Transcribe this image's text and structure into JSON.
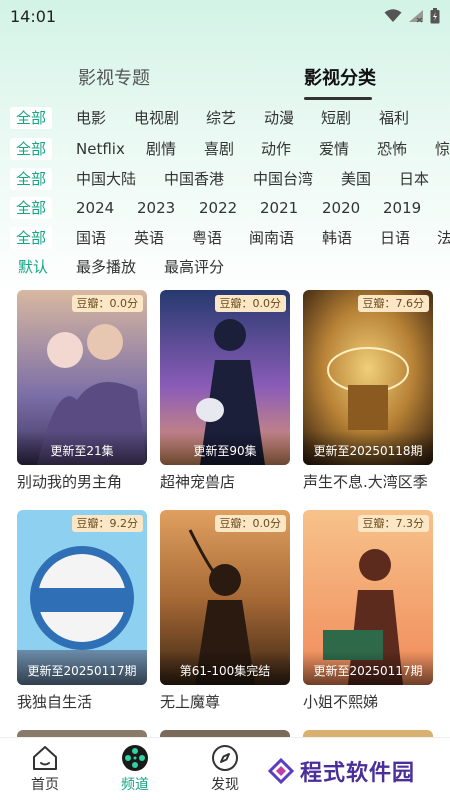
{
  "status": {
    "time": "14:01"
  },
  "top_tabs": [
    {
      "label": "影视专题"
    },
    {
      "label": "影视分类"
    }
  ],
  "filters": {
    "row1": [
      "全部",
      "电影",
      "电视剧",
      "综艺",
      "动漫",
      "短剧",
      "福利"
    ],
    "row2": [
      "全部",
      "Netflix",
      "剧情",
      "喜剧",
      "动作",
      "爱情",
      "恐怖",
      "惊"
    ],
    "row3": [
      "全部",
      "中国大陆",
      "中国香港",
      "中国台湾",
      "美国",
      "日本"
    ],
    "row4": [
      "全部",
      "2024",
      "2023",
      "2022",
      "2021",
      "2020",
      "2019"
    ],
    "row5": [
      "全部",
      "国语",
      "英语",
      "粤语",
      "闽南语",
      "韩语",
      "日语",
      "法"
    ],
    "sort": [
      "默认",
      "最多播放",
      "最高评分"
    ]
  },
  "cards": [
    {
      "title": "别动我的男主角",
      "rating": "豆瓣：0.0分",
      "update": "更新至21集",
      "colors": [
        "#d8b8a0",
        "#7c6fa7",
        "#f2d8d0"
      ]
    },
    {
      "title": "超神宠兽店",
      "rating": "豆瓣：0.0分",
      "update": "更新至90集",
      "colors": [
        "#263a6e",
        "#8a5cb8",
        "#e49a6a"
      ]
    },
    {
      "title": "声生不息.大湾区季",
      "rating": "豆瓣：7.6分",
      "update": "更新至20250118期",
      "colors": [
        "#3a2410",
        "#b88236",
        "#f0cf7a"
      ]
    },
    {
      "title": "我独自生活",
      "rating": "豆瓣：9.2分",
      "update": "更新至20250117期",
      "colors": [
        "#8ed0ef",
        "#2f6fb6",
        "#f4f4f4"
      ]
    },
    {
      "title": "无上魔尊",
      "rating": "豆瓣：0.0分",
      "update": "第61-100集完结",
      "colors": [
        "#3b2614",
        "#a86a36",
        "#e0a060"
      ]
    },
    {
      "title": "小姐不熙娣",
      "rating": "豆瓣：7.3分",
      "update": "更新至20250117期",
      "colors": [
        "#f08a5a",
        "#f7c28a",
        "#5d2a1e"
      ]
    }
  ],
  "bottom_nav": [
    {
      "label": "首页"
    },
    {
      "label": "频道"
    },
    {
      "label": "发现"
    }
  ],
  "watermark": {
    "text": "程式软件园"
  },
  "theme": {
    "accent": "#14a585"
  }
}
